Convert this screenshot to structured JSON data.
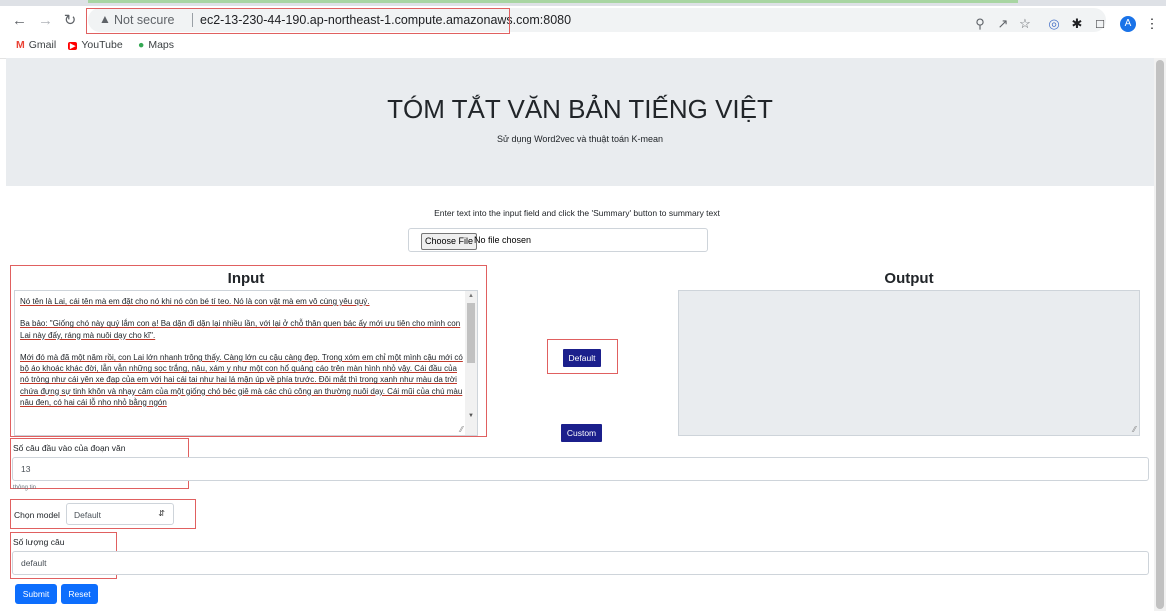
{
  "browser": {
    "security_label": "Not secure",
    "url": "ec2-13-230-44-190.ap-northeast-1.compute.amazonaws.com:8080",
    "profile_initial": "A",
    "bookmarks": [
      {
        "label": "Gmail",
        "icon": "gmail-icon"
      },
      {
        "label": "YouTube",
        "icon": "youtube-icon"
      },
      {
        "label": "Maps",
        "icon": "maps-icon"
      }
    ]
  },
  "header": {
    "title": "TÓM TẮT VĂN BẢN TIẾNG VIỆT",
    "subtitle": "Sử dụng Word2vec và thuật toán K-mean"
  },
  "upload": {
    "instruction": "Enter text into the input field and click the 'Summary' button to summary text",
    "choose_file_label": "Choose File",
    "status": "No file chosen"
  },
  "input_panel": {
    "heading": "Input",
    "paragraphs": [
      "Nó tên là Lai, cái tên mà em đặt cho nó khi nó còn bé tí teo. Nó là con vật mà em vô cùng yêu quý.",
      "Ba bảo: \"Giống chó này quý lắm con ạ! Ba dặn đi dặn lại nhiều lần, với lại ở chỗ thân quen bác ấy mới ưu tiên cho mình con Lai này đấy, ráng mà nuôi dạy cho kĩ\".",
      "Mới đó mà đã một năm rồi, con Lai lớn nhanh trông thấy. Càng lớn cu cậu càng đẹp. Trong xóm em chỉ một mình cậu mới có bộ áo khoác khác đời, lẫn vẫn những sọc trắng, nâu, xám y như một con hổ quảng cáo trên màn hình nhỏ vậy. Cái đầu của nó tròng như cái yên xe đạp của em với hai cái tai như hai lá mận úp về phía trước. Đôi mắt thì trong xanh như màu da trời chứa đựng sự tinh khôn và nhạy cảm của một giống chó béc giê mà các chú công an thường nuôi dạy. Cái mũi của chú màu nâu đen, có hai cái lỗ nho nhỏ bằng ngón"
    ]
  },
  "output_panel": {
    "heading": "Output"
  },
  "actions": {
    "default_label": "Default",
    "custom_label": "Custom",
    "submit_label": "Submit",
    "reset_label": "Reset"
  },
  "form": {
    "sentence_count_label": "Số câu đầu vào của đoạn văn",
    "sentence_count_value": "13",
    "sentence_count_help": "thông tin",
    "model_label": "Chọn model",
    "model_selected": "Default",
    "summary_count_label": "Số lượng câu",
    "summary_count_value": "default"
  }
}
